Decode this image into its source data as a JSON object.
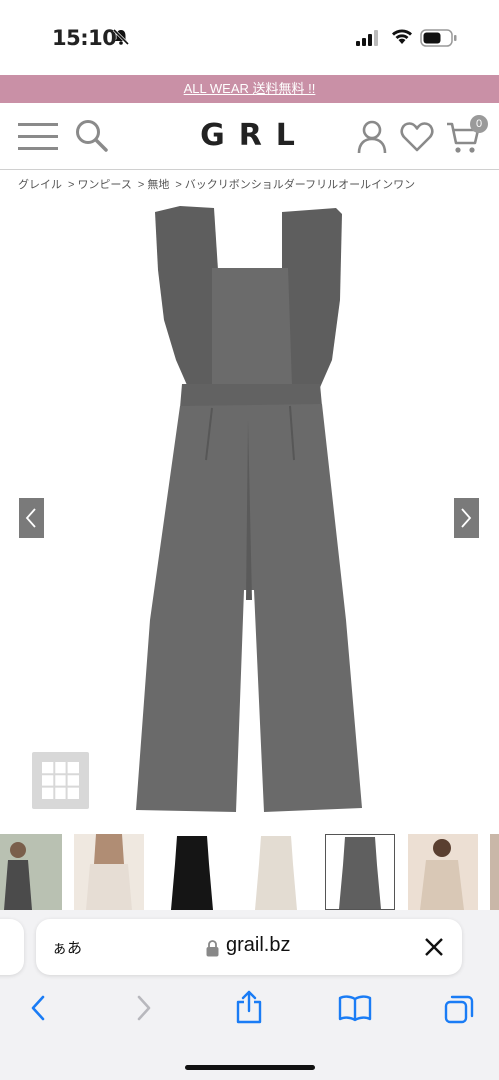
{
  "status_bar": {
    "time": "15:10"
  },
  "banner": {
    "text": "ALL WEAR 送料無料 !!"
  },
  "header": {
    "logo": "GRL",
    "cart_count": "0"
  },
  "breadcrumb": {
    "items": [
      "グレイル",
      "ワンピース",
      "無地",
      "バックリボンショルダーフリルオールインワン"
    ]
  },
  "product": {
    "color": "#6a6a6a",
    "thumbnails": [
      {
        "name": "model-outdoor"
      },
      {
        "name": "model-back-white"
      },
      {
        "name": "item-black"
      },
      {
        "name": "item-beige"
      },
      {
        "name": "item-gray",
        "selected": true
      },
      {
        "name": "model-beige"
      },
      {
        "name": "model-partial"
      }
    ]
  },
  "browser": {
    "aa_label": "ぁあ",
    "url": "grail.bz"
  }
}
